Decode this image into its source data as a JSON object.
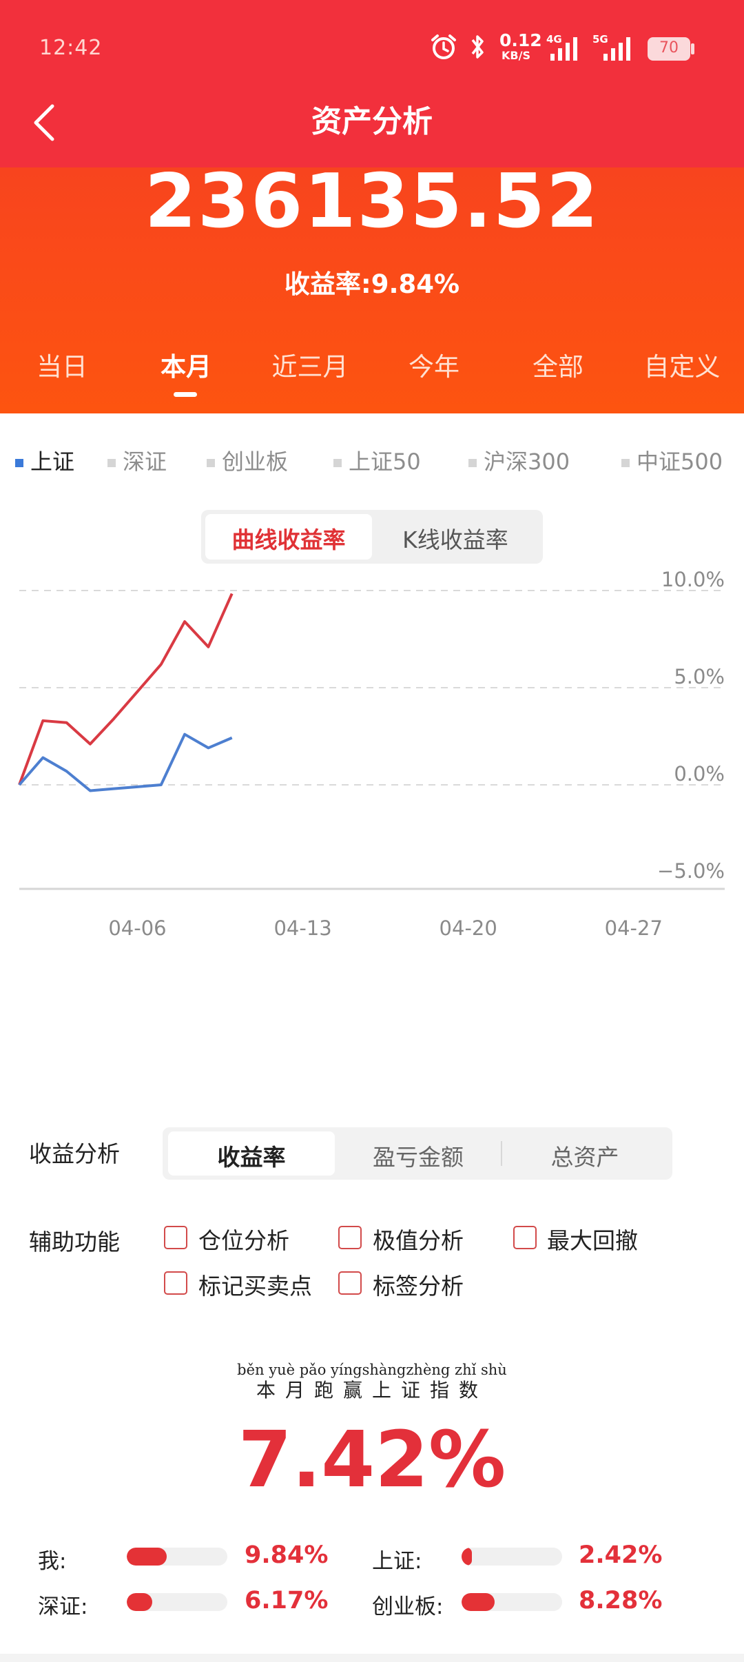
{
  "status_bar": {
    "time": "12:42",
    "net_speed": "0.12",
    "net_unit": "KB/S",
    "sig1": "4G",
    "sig2": "5G",
    "battery": "70",
    "icons": [
      "alarm-icon",
      "bluetooth-icon",
      "signal-icon",
      "battery-icon"
    ]
  },
  "nav": {
    "title": "资产分析",
    "back_icon": "chevron-left-icon"
  },
  "summary": {
    "amount": "236135.52",
    "rate": "收益率:9.84%"
  },
  "period_tabs": [
    {
      "label": "当日",
      "active": false
    },
    {
      "label": "本月",
      "active": true
    },
    {
      "label": "近三月",
      "active": false
    },
    {
      "label": "今年",
      "active": false
    },
    {
      "label": "全部",
      "active": false
    },
    {
      "label": "自定义",
      "active": false
    }
  ],
  "index_options": [
    {
      "label": "上证",
      "active": true
    },
    {
      "label": "深证",
      "active": false
    },
    {
      "label": "创业板",
      "active": false
    },
    {
      "label": "上证50",
      "active": false
    },
    {
      "label": "沪深300",
      "active": false
    },
    {
      "label": "中证500",
      "active": false
    }
  ],
  "chart_toggle": {
    "option1": "曲线收益率",
    "option2": "K线收益率",
    "active": "曲线收益率"
  },
  "chart_data": {
    "type": "line",
    "x_tick_labels": [
      "04-06",
      "04-13",
      "04-20",
      "04-27"
    ],
    "y_tick_labels": [
      "10.0%",
      "5.0%",
      "0.0%",
      "−5.0%"
    ],
    "ylim": [
      -5,
      10
    ],
    "grid": true,
    "series": [
      {
        "color": "#d93a43",
        "x": [
          "04-01",
          "04-02",
          "04-03",
          "04-04",
          "04-05",
          "04-06",
          "04-07",
          "04-08",
          "04-09",
          "04-10"
        ],
        "y": [
          0.0,
          3.3,
          3.2,
          2.1,
          3.4,
          4.8,
          6.2,
          8.4,
          7.1,
          9.84
        ]
      },
      {
        "color": "#4d7fd0",
        "x": [
          "04-01",
          "04-02",
          "04-03",
          "04-04",
          "04-05",
          "04-06",
          "04-07",
          "04-08",
          "04-09",
          "04-10"
        ],
        "y": [
          0.0,
          1.4,
          0.7,
          -0.3,
          -0.2,
          -0.1,
          0.0,
          2.6,
          1.9,
          2.42
        ]
      }
    ]
  },
  "analysis": {
    "label": "收益分析",
    "options": [
      "收益率",
      "盈亏金额",
      "总资产"
    ],
    "active": "收益率"
  },
  "aux": {
    "label": "辅助功能",
    "items": [
      "仓位分析",
      "极值分析",
      "最大回撤",
      "标记买卖点",
      "标签分析"
    ]
  },
  "outperform": {
    "pinyin": "běn yuè pǎo yíngshàngzhèng zhǐ shù",
    "text": "本月跑赢上证指数",
    "value": "7.42%"
  },
  "comparison": [
    {
      "label": "我:",
      "value": "9.84%",
      "fill": 0.4
    },
    {
      "label": "上证:",
      "value": "2.42%",
      "fill": 0.1
    },
    {
      "label": "深证:",
      "value": "6.17%",
      "fill": 0.25
    },
    {
      "label": "创业板:",
      "value": "8.28%",
      "fill": 0.33
    }
  ]
}
